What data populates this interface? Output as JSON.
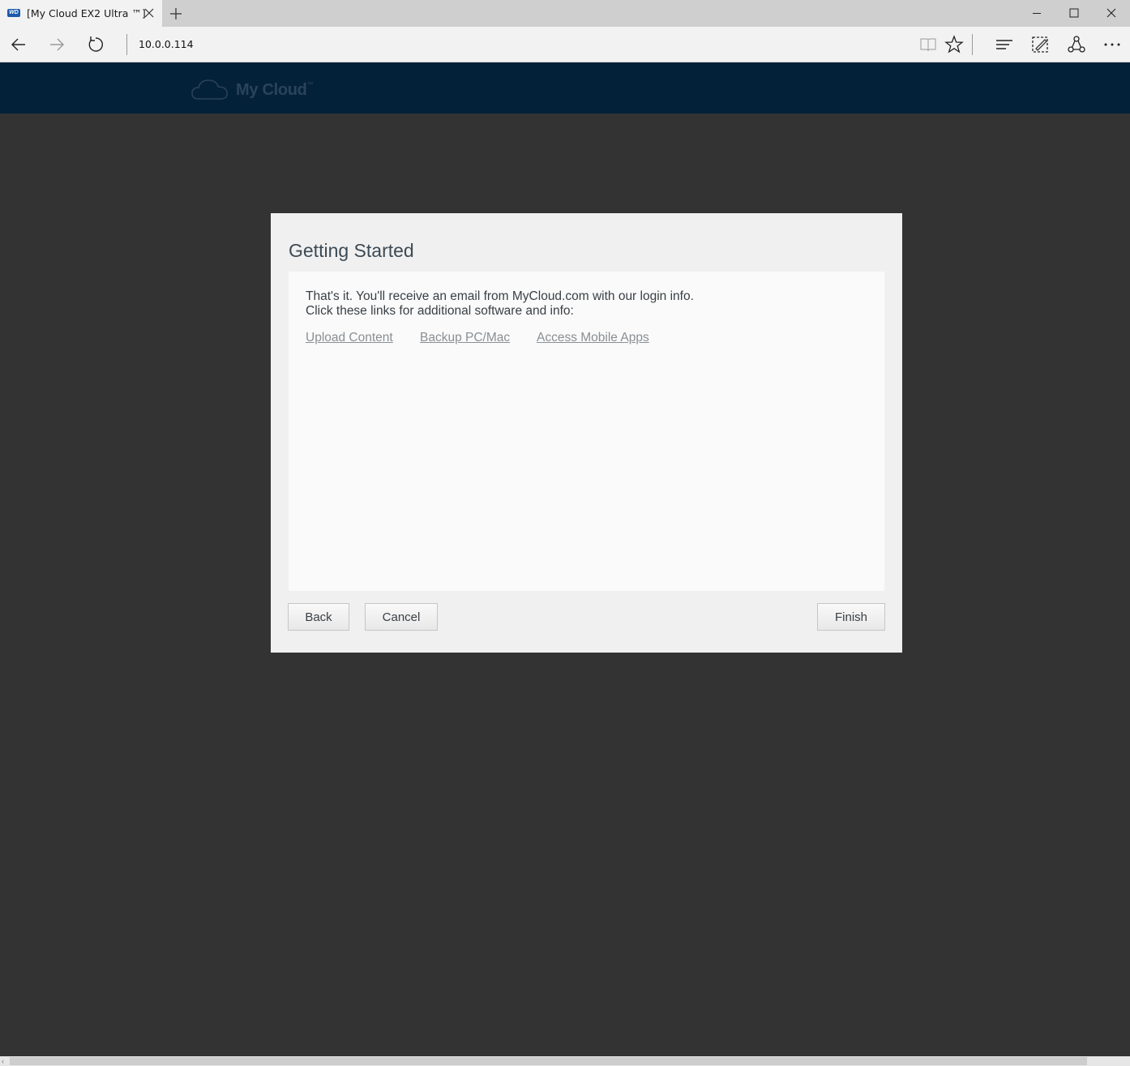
{
  "browser": {
    "tab_title": "[My Cloud EX2 Ultra ™]",
    "favicon_text": "WD",
    "url": "10.0.0.114"
  },
  "app": {
    "brand": "My Cloud",
    "brand_mark": "™"
  },
  "dialog": {
    "title": "Getting Started",
    "message_line1": "That's it. You'll receive an email from MyCloud.com with our login info.",
    "message_line2": "Click these links for additional software and info:",
    "links": [
      "Upload Content",
      "Backup PC/Mac",
      "Access Mobile Apps"
    ],
    "buttons": {
      "back": "Back",
      "cancel": "Cancel",
      "finish": "Finish"
    }
  },
  "colors": {
    "header_bg": "#04213a",
    "page_bg": "#333333",
    "dialog_bg": "#f0f0f0",
    "link": "#8a8f93"
  },
  "icons": [
    "back-arrow-icon",
    "forward-arrow-icon",
    "refresh-icon",
    "reading-view-icon",
    "favorite-star-icon",
    "hub-icon",
    "web-note-icon",
    "share-icon",
    "more-icon",
    "cloud-logo-icon"
  ]
}
